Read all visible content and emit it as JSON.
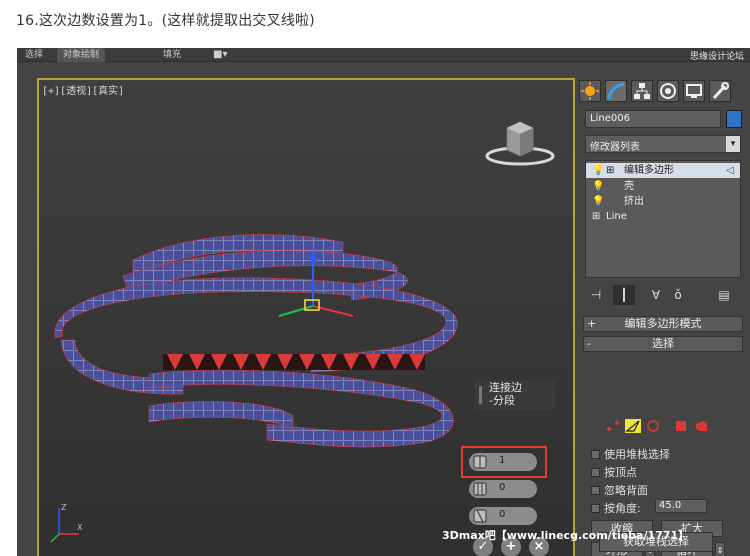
{
  "caption": "16.这次边数设置为1。(这样就提取出交叉线啦)",
  "topbar": {
    "tabs": [
      "选择",
      "对象绘制",
      "填充"
    ],
    "watermark": "思缘设计论坛"
  },
  "viewport": {
    "label": "[+][透视][真实]"
  },
  "caddy": {
    "title_line1": "连接边",
    "title_line2": "-分段",
    "segments_value": "1",
    "pinch_value": "0",
    "slide_value": "0"
  },
  "panel": {
    "object_name": "Line006",
    "modifier_list": "修改器列表",
    "stack": [
      "编辑多边形",
      "壳",
      "挤出",
      "Line"
    ],
    "rollout_edit_mode": "编辑多边形模式",
    "rollout_selection": "选择",
    "use_stack_selection": "使用堆栈选择",
    "by_vertex": "按顶点",
    "ignore_backfacing": "忽略背面",
    "by_angle": "按角度:",
    "angle_value": "45.0",
    "shrink": "收缩",
    "grow": "扩大",
    "ring": "环形",
    "loop": "循环",
    "get_stack_selection": "获取堆栈选择"
  },
  "footer_watermark": "3Dmax吧【www.linecg.com/tieba/1771】",
  "colors": {
    "object_color": "#2e75c8",
    "viewport_border": "#b9a23a",
    "highlight_red": "#e33b2e"
  }
}
